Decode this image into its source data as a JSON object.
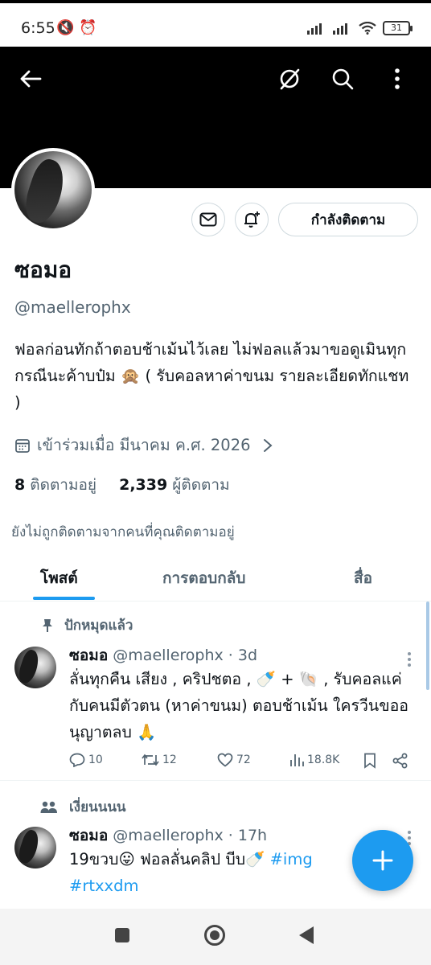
{
  "status_bar": {
    "time": "6:55",
    "battery": "31"
  },
  "profile": {
    "name": "ซอมอ",
    "handle": "@maellerophx",
    "bio": "ฟอลก่อนทักถ้าตอบช้าเม้นไว้เลย ไม่ฟอลแล้วมาขอดูเมินทุกกรณีนะค้าบป๋ม 🙊 ( รับคอลหาค่าขนม รายละเอียดทักแชท )",
    "joined": "เข้าร่วมเมื่อ มีนาคม ค.ศ. 2026",
    "following_count": "8",
    "following_label": "ติดตามอยู่",
    "followers_count": "2,339",
    "followers_label": "ผู้ติดตาม",
    "not_followed_note": "ยังไม่ถูกติดตามจากคนที่คุณติดตามอยู่",
    "follow_button": "กำลังติดตาม"
  },
  "tabs": [
    {
      "label": "โพสต์"
    },
    {
      "label": "การตอบกลับ"
    },
    {
      "label": "สื่อ"
    }
  ],
  "posts": [
    {
      "context_label": "ปักหมุดแล้ว",
      "name": "ซอมอ",
      "handle": "@maellerophx",
      "time": "· 3d",
      "text": "ลั่นทุกคืน เสียง , คริปชตอ , 🍼 + 🐚 , รับคอลแค่กับคนมีตัวตน (หาค่าขนม) ตอบช้าเม้น ใครวีนขออนุญาตลบ 🙏",
      "replies": "10",
      "reposts": "12",
      "likes": "72",
      "views": "18.8K"
    },
    {
      "context_label": "เงี่ยนนนน",
      "name": "ซอมอ",
      "handle": "@maellerophx",
      "time": "· 17h",
      "text_main": "19ขวบ😛 ฟอลลั่นคลิป บีบ🍼 ",
      "hashtag1": "#img",
      "hashtag2": "#rtxxdm"
    }
  ]
}
